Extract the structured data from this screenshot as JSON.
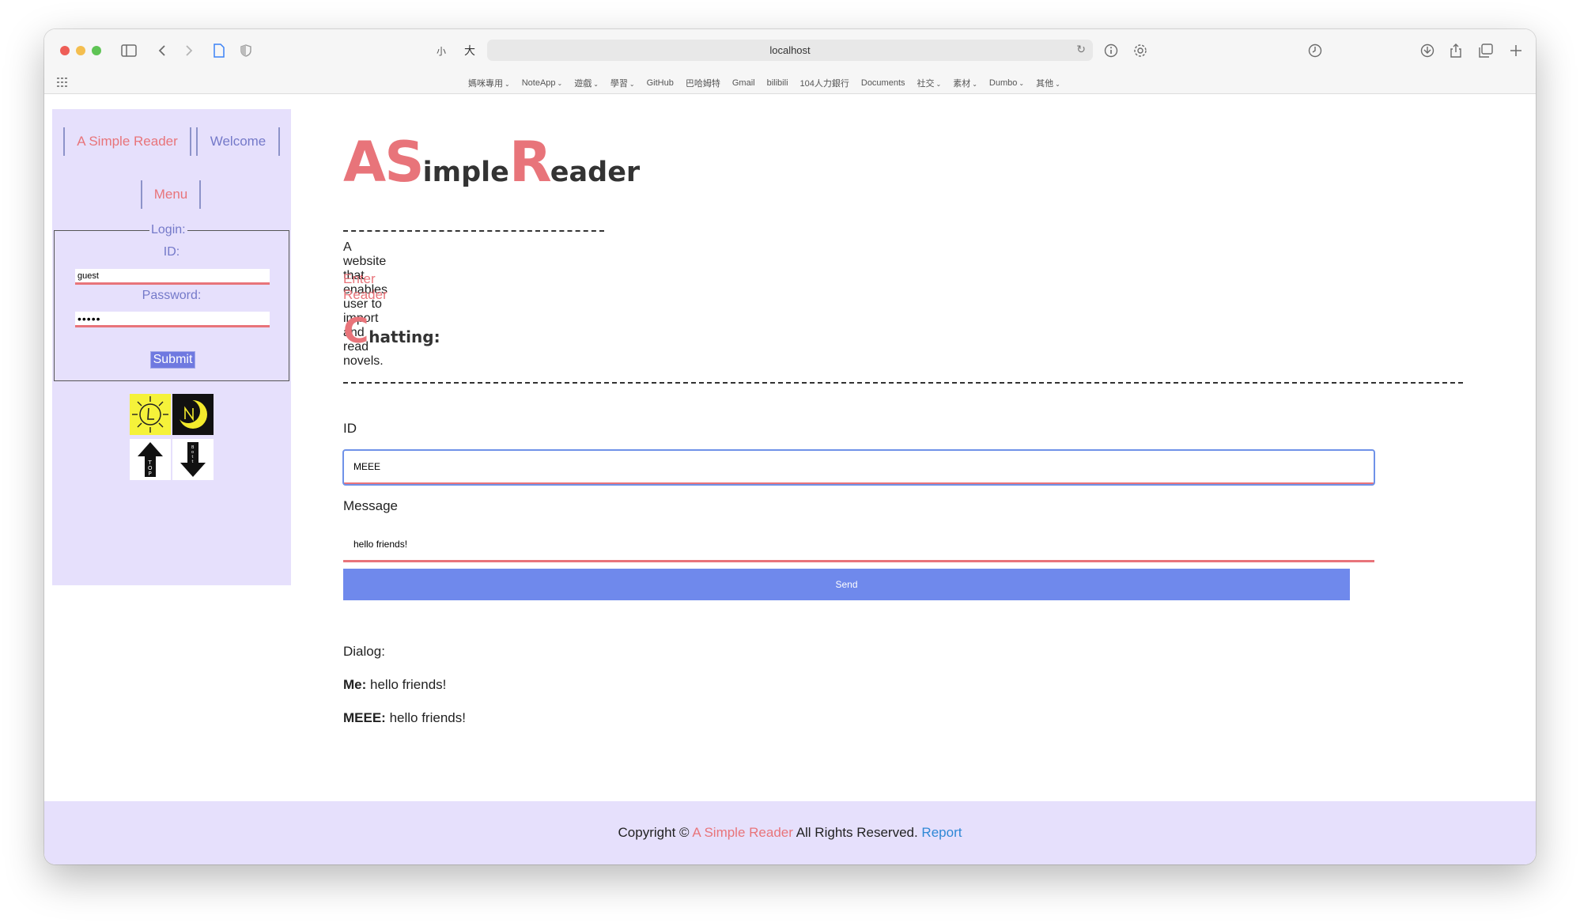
{
  "browser": {
    "url": "localhost",
    "text_small_label": "小",
    "text_large_label": "大",
    "bookmarks": [
      {
        "label": "媽咪專用",
        "has_menu": true
      },
      {
        "label": "NoteApp",
        "has_menu": true
      },
      {
        "label": "遊戲",
        "has_menu": true
      },
      {
        "label": "學習",
        "has_menu": true
      },
      {
        "label": "GitHub",
        "has_menu": false
      },
      {
        "label": "巴哈姆特",
        "has_menu": false
      },
      {
        "label": "Gmail",
        "has_menu": false
      },
      {
        "label": "bilibili",
        "has_menu": false
      },
      {
        "label": "104人力銀行",
        "has_menu": false
      },
      {
        "label": "Documents",
        "has_menu": false
      },
      {
        "label": "社交",
        "has_menu": true
      },
      {
        "label": "素材",
        "has_menu": true
      },
      {
        "label": "Dumbo",
        "has_menu": true
      },
      {
        "label": "其他",
        "has_menu": true
      }
    ]
  },
  "sidebar": {
    "nav_home": "A Simple Reader",
    "nav_welcome": "Welcome",
    "nav_menu": "Menu",
    "login": {
      "legend": "Login:",
      "id_label": "ID:",
      "id_value": "guest",
      "password_label": "Password:",
      "password_value": "•••••",
      "submit_label": "Submit"
    },
    "icons": [
      "light-mode-sun-icon",
      "dark-mode-moon-icon",
      "scroll-top-arrow-icon",
      "scroll-bottom-arrow-icon"
    ]
  },
  "main": {
    "brand": {
      "a": "A",
      "s": "S",
      "imple": "imple",
      "r": "R",
      "eader": "eader"
    },
    "intro": "A website that enables user to import and read novels.",
    "enter_link": "Enter Reader",
    "chat": {
      "title_initial": "C",
      "title_rest": "hatting:",
      "id_label": "ID",
      "id_value": "MEEE",
      "message_label": "Message",
      "message_value": "hello friends!",
      "send_label": "Send",
      "dialog_label": "Dialog:",
      "messages": [
        {
          "sender": "Me:",
          "text": " hello friends!"
        },
        {
          "sender": "MEEE:",
          "text": " hello friends!"
        }
      ]
    }
  },
  "footer": {
    "prefix": "Copyright © ",
    "brand": "A Simple Reader",
    "middle": " All Rights Reserved. ",
    "report_link": "Report"
  },
  "colors": {
    "accent_pink": "#e8747a",
    "accent_blue": "#7479c9",
    "sidebar_bg": "#e6e0fc",
    "send_button": "#6f89ec",
    "link_blue": "#2f88d6"
  }
}
